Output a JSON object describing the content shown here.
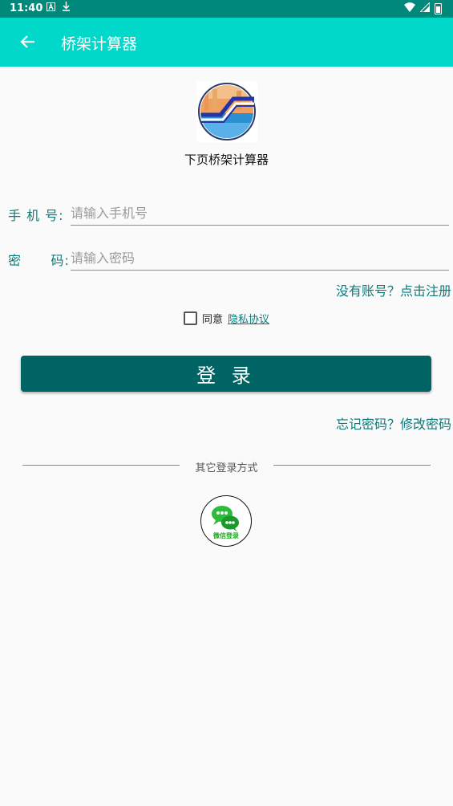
{
  "status_bar": {
    "time": "11:40",
    "icons": [
      "a-icon",
      "download-icon",
      "wifi-icon",
      "signal-icon",
      "battery-icon"
    ]
  },
  "app_bar": {
    "title": "桥架计算器",
    "back_icon": "arrow-left-icon"
  },
  "header": {
    "app_name": "下页桥架计算器"
  },
  "form": {
    "phone_label": "手 机 号:",
    "phone_placeholder": "请输入手机号",
    "phone_value": "",
    "password_label": "密      码:",
    "password_placeholder": "请输入密码",
    "password_value": ""
  },
  "links": {
    "register": "没有账号？点击注册",
    "forgot": "忘记密码？修改密码"
  },
  "agreement": {
    "agree_text": "同意",
    "privacy_link": "隐私协议",
    "checked": false
  },
  "buttons": {
    "login_label": "登 录"
  },
  "other_login": {
    "divider_text": "其它登录方式",
    "wechat_label": "微信登录"
  },
  "colors": {
    "status_bar": "#00897b",
    "app_bar": "#00d9c9",
    "primary_button": "#006465",
    "link": "#0e7a7a",
    "wechat_green": "#1aad19"
  }
}
